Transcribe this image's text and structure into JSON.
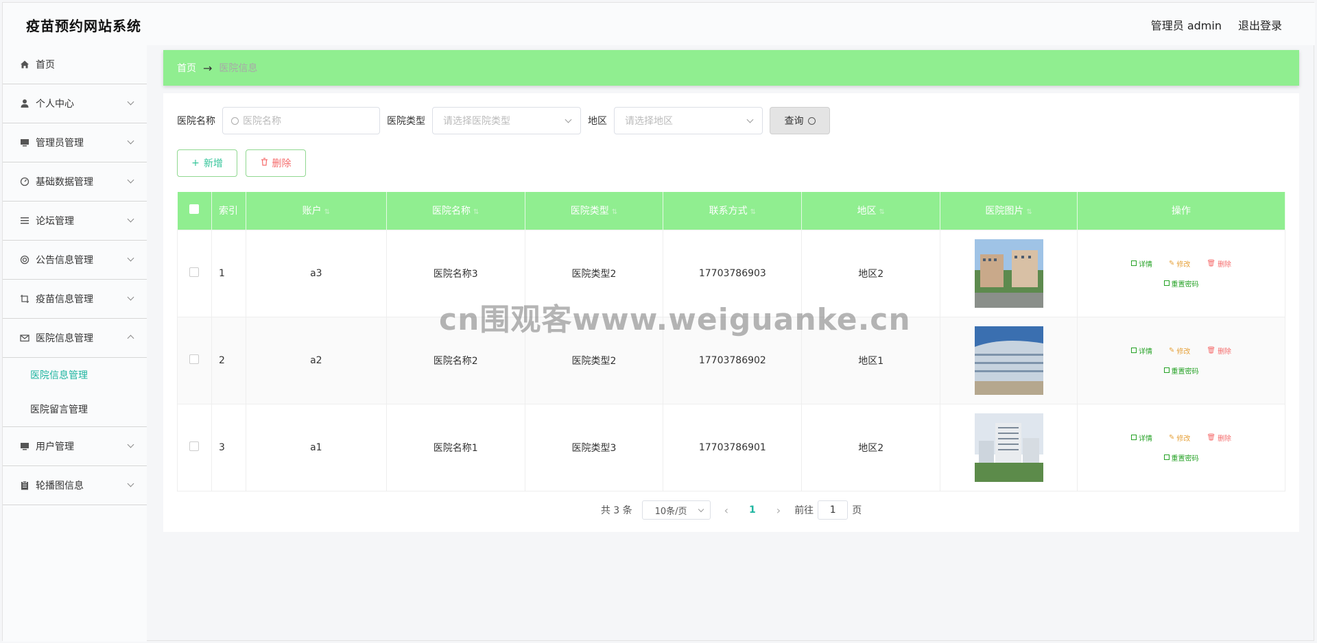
{
  "header": {
    "title": "疫苗预约网站系统",
    "admin_label": "管理员 admin",
    "logout_label": "退出登录"
  },
  "sidebar": {
    "items": [
      {
        "label": "首页",
        "icon": "home-icon",
        "expandable": false
      },
      {
        "label": "个人中心",
        "icon": "user-icon",
        "expandable": true
      },
      {
        "label": "管理员管理",
        "icon": "monitor-icon",
        "expandable": true
      },
      {
        "label": "基础数据管理",
        "icon": "gauge-icon",
        "expandable": true
      },
      {
        "label": "论坛管理",
        "icon": "list-icon",
        "expandable": true
      },
      {
        "label": "公告信息管理",
        "icon": "lifebuoy-icon",
        "expandable": true
      },
      {
        "label": "疫苗信息管理",
        "icon": "crop-icon",
        "expandable": true
      },
      {
        "label": "医院信息管理",
        "icon": "mail-icon",
        "expandable": true,
        "expanded": true
      },
      {
        "label": "用户管理",
        "icon": "monitor-icon",
        "expandable": true
      },
      {
        "label": "轮播图信息",
        "icon": "clipboard-icon",
        "expandable": true
      }
    ],
    "submenu": [
      {
        "label": "医院信息管理",
        "active": true
      },
      {
        "label": "医院留言管理",
        "active": false
      }
    ]
  },
  "breadcrumb": {
    "home": "首页",
    "arrow": "→",
    "current": "医院信息"
  },
  "search": {
    "name_label": "医院名称",
    "name_placeholder": "医院名称",
    "type_label": "医院类型",
    "type_placeholder": "请选择医院类型",
    "region_label": "地区",
    "region_placeholder": "请选择地区",
    "query_label": "查询"
  },
  "actions": {
    "add_label": "新增",
    "delete_label": "删除"
  },
  "table": {
    "headers": {
      "index": "索引",
      "account": "账户",
      "name": "医院名称",
      "type": "医院类型",
      "phone": "联系方式",
      "region": "地区",
      "photo": "医院图片",
      "ops": "操作"
    },
    "rows": [
      {
        "index": "1",
        "account": "a3",
        "name": "医院名称3",
        "type": "医院类型2",
        "phone": "17703786903",
        "region": "地区2"
      },
      {
        "index": "2",
        "account": "a2",
        "name": "医院名称2",
        "type": "医院类型2",
        "phone": "17703786902",
        "region": "地区1"
      },
      {
        "index": "3",
        "account": "a1",
        "name": "医院名称1",
        "type": "医院类型3",
        "phone": "17703786901",
        "region": "地区2"
      }
    ],
    "op_labels": {
      "detail": "详情",
      "edit": "修改",
      "delete": "删除",
      "reset": "重置密码"
    }
  },
  "pagination": {
    "total": "共 3 条",
    "page_size": "10条/页",
    "current_page": "1",
    "goto_prefix": "前往",
    "goto_value": "1",
    "goto_suffix": "页"
  },
  "watermark": "cn围观客www.weiguanke.cn",
  "colors": {
    "accent_green": "#90ee90",
    "active_teal": "#1fb5a0",
    "danger": "#f56c6c",
    "warning": "#e6a23c"
  }
}
